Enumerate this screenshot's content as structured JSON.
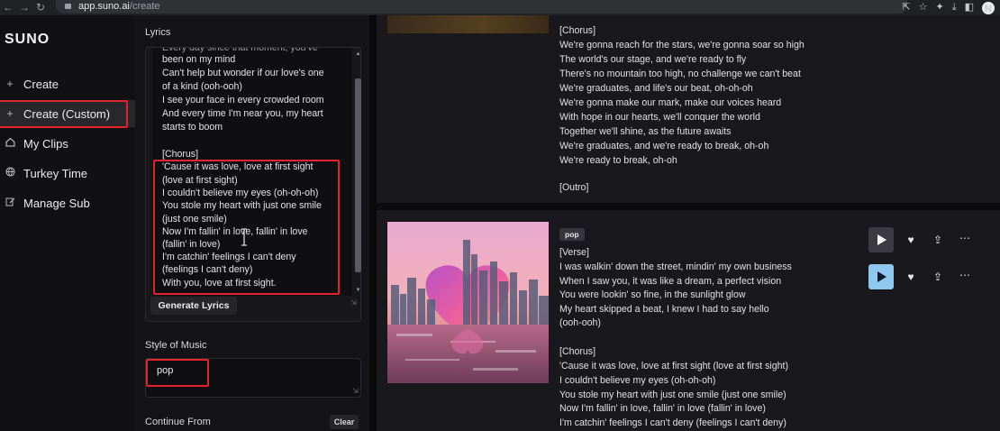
{
  "browser": {
    "url_host": "app.suno.ai",
    "url_path": "/create"
  },
  "sidebar": {
    "logo": "SUNO",
    "items": [
      {
        "label": "Create",
        "icon": "plus-icon"
      },
      {
        "label": "Create (Custom)",
        "icon": "plus-icon",
        "active": true
      },
      {
        "label": "My Clips",
        "icon": "home-icon"
      },
      {
        "label": "Turkey Time",
        "icon": "globe-icon"
      },
      {
        "label": "Manage Sub",
        "icon": "edit-icon"
      }
    ]
  },
  "middle": {
    "lyrics_label": "Lyrics",
    "lyrics_lines": [
      "been on my mind",
      "Can't help but wonder if our love's one",
      "of a kind (ooh-ooh)",
      "I see your face in every crowded room",
      "And every time I'm near you, my heart",
      "starts to boom",
      "",
      "[Chorus]",
      "'Cause it was love, love at first sight",
      "(love at first sight)",
      "I couldn't believe my eyes (oh-oh-oh)",
      "You stole my heart with just one smile",
      "(just one smile)",
      "Now I'm fallin' in love, fallin' in love",
      "(fallin' in love)",
      "I'm catchin' feelings I can't deny",
      "(feelings I can't deny)",
      "With you, love at first sight."
    ],
    "generate_button": "Generate Lyrics",
    "style_label": "Style of Music",
    "style_value": "pop",
    "continue_label": "Continue From",
    "clear_button": "Clear"
  },
  "right": {
    "card1_lines": [
      "[Chorus]",
      "We're gonna reach for the stars, we're gonna soar so high",
      "The world's our stage, and we're ready to fly",
      "There's no mountain too high, no challenge we can't beat",
      "We're graduates, and life's our beat, oh-oh-oh",
      "We're gonna make our mark, make our voices heard",
      "With hope in our hearts, we'll conquer the world",
      "Together we'll shine, as the future awaits",
      "We're graduates, and we're ready to break, oh-oh",
      "We're ready to break, oh-oh",
      "",
      "[Outro]"
    ],
    "card2_tag": "pop",
    "card2_lines": [
      "[Verse]",
      "I was walkin' down the street, mindin' my own business",
      "When I saw you, it was like a dream, a perfect vision",
      "You were lookin' so fine, in the sunlight glow",
      "My heart skipped a beat, I knew I had to say hello",
      "(ooh-ooh)",
      "",
      "[Chorus]",
      "'Cause it was love, love at first sight (love at first sight)",
      "I couldn't believe my eyes (oh-oh-oh)",
      "You stole my heart with just one smile (just one smile)",
      "Now I'm fallin' in love, fallin' in love (fallin' in love)",
      "I'm catchin' feelings I can't deny (feelings I can't deny)"
    ]
  },
  "colors": {
    "accent_red": "#e0262b",
    "play_dark": "#3a3a40",
    "play_light": "#8ec8ee"
  }
}
